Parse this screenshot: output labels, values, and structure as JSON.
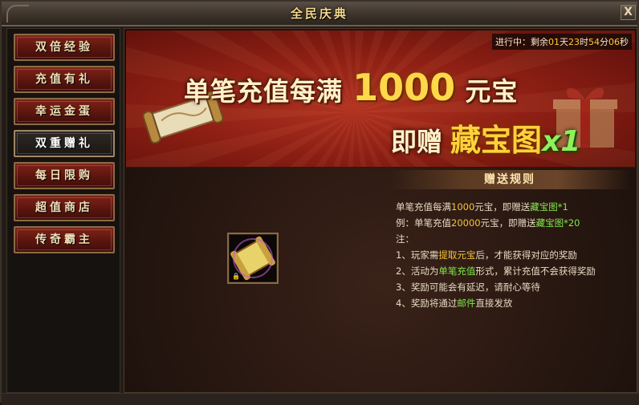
{
  "window": {
    "title": "全民庆典",
    "close_label": "X"
  },
  "sidebar": {
    "items": [
      {
        "label": "双倍经验",
        "active": false
      },
      {
        "label": "充值有礼",
        "active": false
      },
      {
        "label": "幸运金蛋",
        "active": false
      },
      {
        "label": "双重赠礼",
        "active": true
      },
      {
        "label": "每日限购",
        "active": false
      },
      {
        "label": "超值商店",
        "active": false
      },
      {
        "label": "传奇霸主",
        "active": false
      }
    ]
  },
  "banner": {
    "countdown": {
      "prefix": "进行中：剩余",
      "days": "01",
      "days_unit": "天",
      "hours": "23",
      "hours_unit": "时",
      "minutes": "54",
      "minutes_unit": "分",
      "seconds": "06",
      "seconds_unit": "秒"
    },
    "headline_pre": "单笔充值每满",
    "headline_amount": "1000",
    "headline_post": "元宝",
    "sub_pre": "即赠",
    "sub_item": "藏宝图",
    "sub_mult": "x1"
  },
  "rules": {
    "header": "赠送规则",
    "line1": {
      "a": "单笔充值每满",
      "b": "1000",
      "c": "元宝，即赠送",
      "d": "藏宝图*1"
    },
    "line2": {
      "a": "例：单笔充值",
      "b": "20000",
      "c": "元宝，即赠送",
      "d": "藏宝图*20"
    },
    "note": "注：",
    "line3": {
      "a": "1、玩家需",
      "b": "提取元宝",
      "c": "后，才能获得对应的奖励"
    },
    "line4": {
      "a": "2、活动为",
      "b": "单笔充值",
      "c": "形式，累计充值不会获得奖励"
    },
    "line5": "3、奖励可能会有延迟，请耐心等待",
    "line6": {
      "a": "4、奖励将通过",
      "b": "邮件",
      "c": "直接发放"
    }
  },
  "colors": {
    "accent_gold": "#ffd84a",
    "highlight_green": "#7fe84a",
    "button_red": "#7e2318"
  },
  "icons": {
    "reward": "treasure-map-scroll-icon",
    "close": "close-icon"
  }
}
